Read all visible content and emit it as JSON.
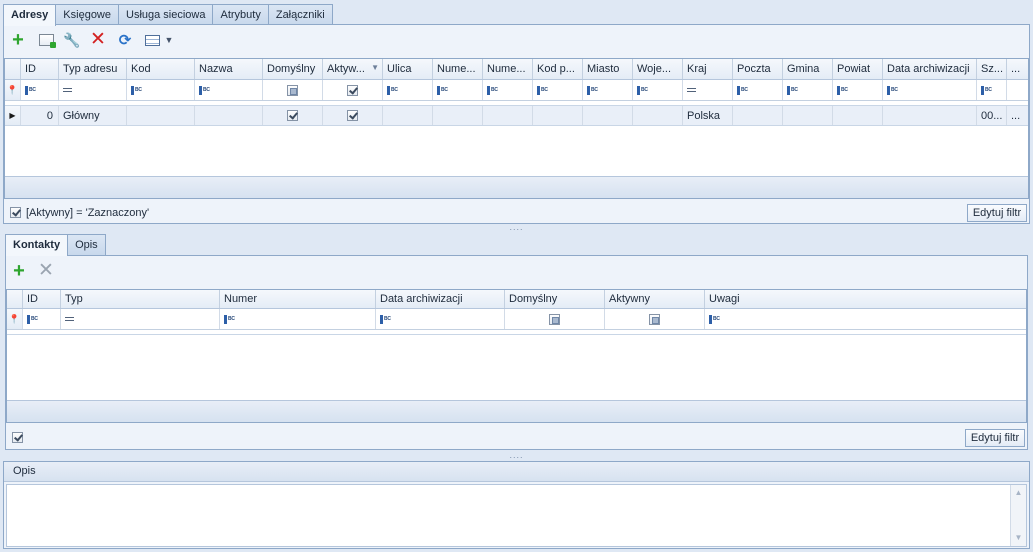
{
  "top_tabs": [
    {
      "label": "Adresy",
      "active": true
    },
    {
      "label": "Księgowe",
      "active": false
    },
    {
      "label": "Usługa sieciowa",
      "active": false
    },
    {
      "label": "Atrybuty",
      "active": false
    },
    {
      "label": "Załączniki",
      "active": false
    }
  ],
  "addresses": {
    "toolbar": [
      "add-icon",
      "add-image-icon",
      "edit-wrench-icon",
      "delete-icon",
      "refresh-icon",
      "grid-view-icon",
      "dropdown-caret-icon"
    ],
    "columns": [
      "ID",
      "Typ adresu",
      "Kod",
      "Nazwa",
      "Domyślny",
      "Aktyw...",
      "Ulica",
      "Nume...",
      "Nume...",
      "Kod p...",
      "Miasto",
      "Woje...",
      "Kraj",
      "Poczta",
      "Gmina",
      "Powiat",
      "Data archiwizacji",
      "Sz...",
      "..."
    ],
    "row": {
      "id": "0",
      "type": "Główny",
      "country": "Polska",
      "trunc": "00...",
      "more": "...",
      "default_checked": true,
      "active_checked": true
    },
    "filter_text": "[Aktywny] = 'Zaznaczony'",
    "edit_filter_label": "Edytuj filtr"
  },
  "sub_tabs": [
    {
      "label": "Kontakty",
      "active": true
    },
    {
      "label": "Opis",
      "active": false
    }
  ],
  "contacts": {
    "toolbar": [
      "add-icon",
      "delete-icon"
    ],
    "columns": [
      "ID",
      "Typ",
      "Numer",
      "Data archiwizacji",
      "Domyślny",
      "Aktywny",
      "Uwagi"
    ],
    "edit_filter_label": "Edytuj filtr"
  },
  "description": {
    "title": "Opis",
    "value": ""
  },
  "splitter_glyph": "....",
  "colors": {
    "background": "#dfe8f4",
    "border": "#8ea8c8",
    "add_green": "#2fa52f",
    "delete_red": "#d32020"
  }
}
